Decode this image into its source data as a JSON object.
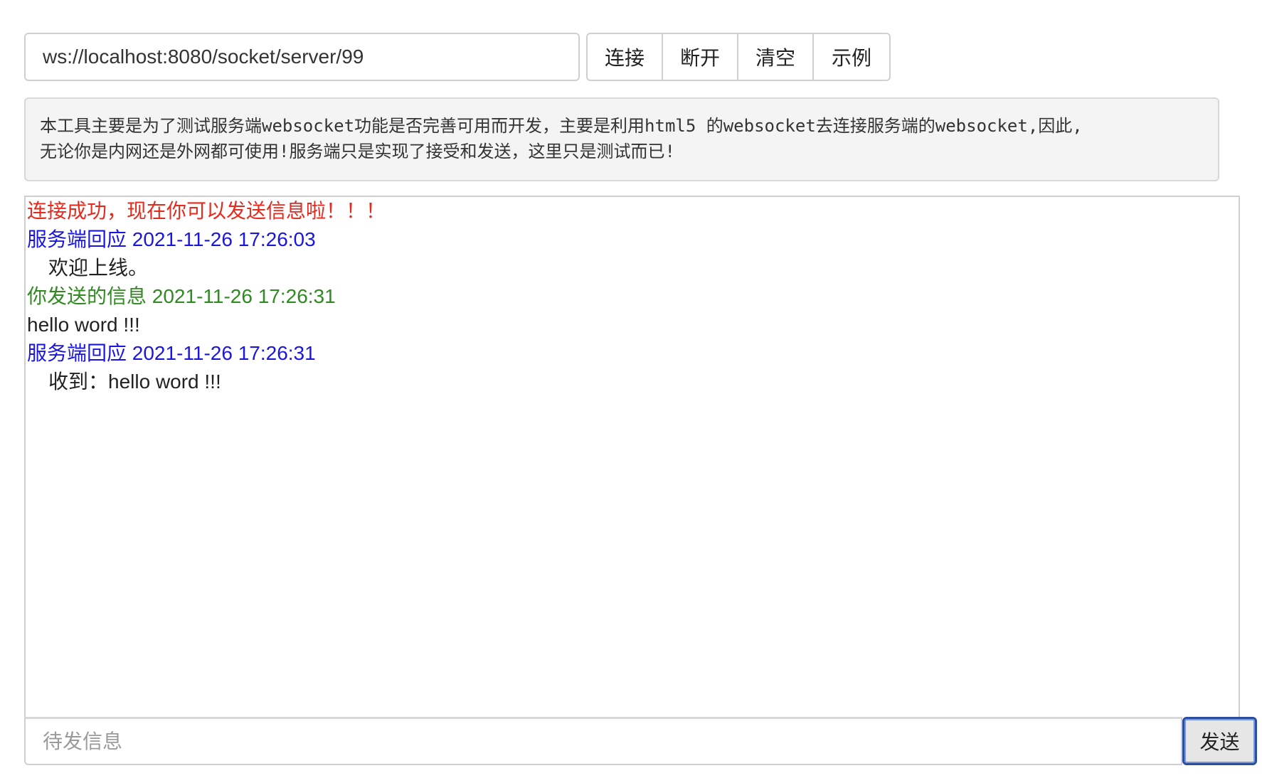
{
  "connection": {
    "url_value": "ws://localhost:8080/socket/server/99",
    "buttons": [
      "连接",
      "断开",
      "清空",
      "示例"
    ]
  },
  "info": {
    "line1": "本工具主要是为了测试服务端websocket功能是否完善可用而开发，主要是利用html5 的websocket去连接服务端的websocket,因此,",
    "line2": "无论你是内网还是外网都可使用!服务端只是实现了接受和发送，这里只是测试而已!"
  },
  "log": [
    {
      "text": "连接成功，现在你可以发送信息啦！！！",
      "color": "#e52a1e"
    },
    {
      "text": "服务端回应 2021-11-26 17:26:03",
      "color": "#1a16e0"
    },
    {
      "text": "欢迎上线。",
      "color": "#222222"
    },
    {
      "text": "你发送的信息 2021-11-26 17:26:31",
      "color": "#2f8a1f"
    },
    {
      "text": "hello word !!!",
      "color": "#222222"
    },
    {
      "text": "服务端回应 2021-11-26 17:26:31",
      "color": "#1a16e0"
    },
    {
      "text": "收到：hello word !!!",
      "color": "#222222"
    }
  ],
  "composer": {
    "placeholder": "待发信息",
    "send_label": "发送"
  }
}
